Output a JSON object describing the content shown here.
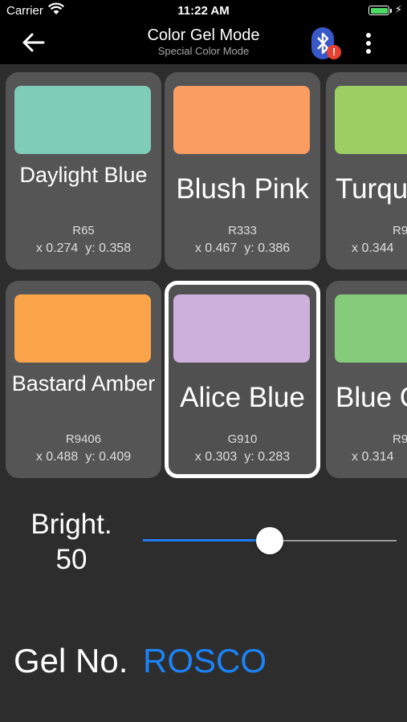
{
  "status_bar": {
    "carrier": "Carrier",
    "time": "11:22 AM",
    "battery_level": 1.0
  },
  "nav": {
    "title": "Color Gel Mode",
    "subtitle": "Special Color Mode",
    "bluetooth_badge": "!"
  },
  "gels": [
    {
      "name": "Daylight Blue",
      "code": "R65",
      "xy": "x 0.274  y: 0.358",
      "color": "#7fccb9",
      "selected": false
    },
    {
      "name": "Blush Pink",
      "code": "R333",
      "xy": "x 0.467  y: 0.386",
      "color": "#f99d63",
      "selected": false
    },
    {
      "name": "Turqu",
      "code": "R9",
      "xy": "x 0.344",
      "color": "#9bcf64",
      "selected": false
    },
    {
      "name": "Bastard Amber",
      "code": "R9406",
      "xy": "x 0.488  y: 0.409",
      "color": "#fba44a",
      "selected": false
    },
    {
      "name": "Alice Blue",
      "code": "G910",
      "xy": "x 0.303  y: 0.283",
      "color": "#cdb1dc",
      "selected": true
    },
    {
      "name": "Blue C",
      "code": "R9",
      "xy": "x 0.314",
      "color": "#84cb7b",
      "selected": false
    }
  ],
  "brightness": {
    "label": "Bright.",
    "value": 50,
    "fraction": 0.5
  },
  "gel_no": {
    "label": "Gel No.",
    "brand": "ROSCO"
  },
  "colors": {
    "accent": "#1c82f5",
    "card": "#555555",
    "background": "#2d2d2d",
    "badge": "#e8402f"
  }
}
